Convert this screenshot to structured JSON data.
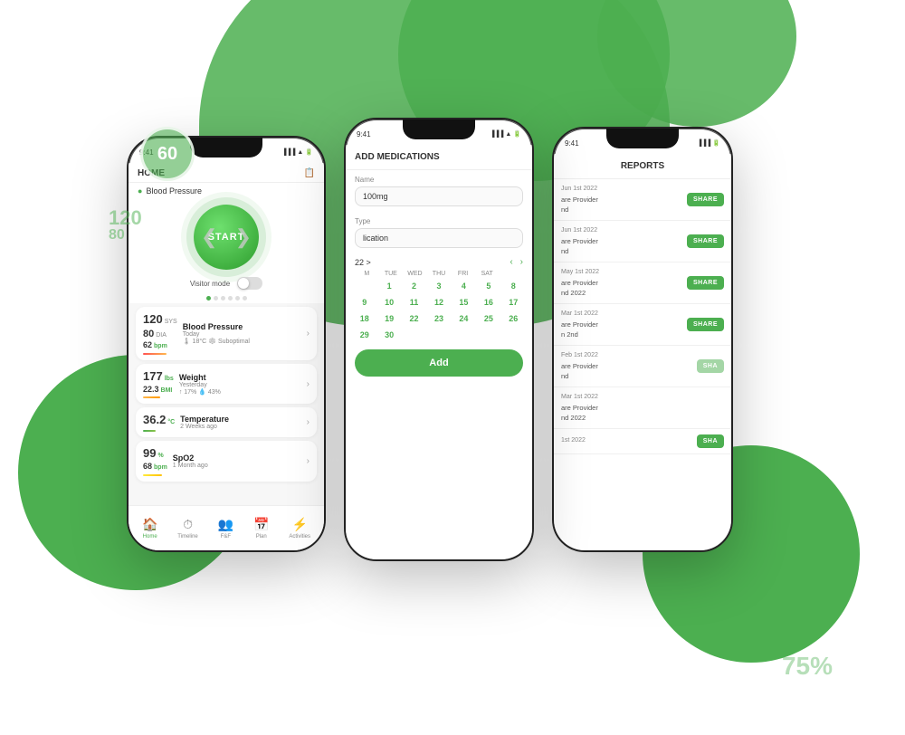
{
  "background": {
    "cloud_color": "#4caf50"
  },
  "phone1": {
    "title": "HOME",
    "blood_pressure_label": "Blood Pressure",
    "start_button": "START",
    "visitor_mode_label": "Visitor mode",
    "cards": [
      {
        "id": "bp",
        "big_value": "120",
        "unit1": "SYS",
        "value2": "80",
        "unit2": "DIA",
        "value3": "62",
        "unit3": "bpm",
        "title": "Blood Pressure",
        "sub": "Today",
        "detail": "🌡 18°C ❄ Suboptimal"
      },
      {
        "id": "weight",
        "big_value": "177",
        "unit1": "lbs",
        "value2": "22.3",
        "unit2": "BMI",
        "title": "Weight",
        "sub": "Yesterday",
        "detail": "↑ 17%  💧 43%"
      },
      {
        "id": "temp",
        "big_value": "36.2",
        "unit1": "°C",
        "title": "Temperature",
        "sub": "2 Weeks ago"
      },
      {
        "id": "spo2",
        "big_value": "99",
        "unit1": "%",
        "value2": "68",
        "unit2": "bpm",
        "title": "SpO2",
        "sub": "1 Month ago"
      }
    ],
    "nav": [
      {
        "label": "Home",
        "icon": "🏠",
        "active": true
      },
      {
        "label": "Timeline",
        "icon": "⏱",
        "active": false
      },
      {
        "label": "F&F",
        "icon": "👥",
        "active": false
      },
      {
        "label": "Plan",
        "icon": "📅",
        "active": false
      },
      {
        "label": "Activities",
        "icon": "⚡",
        "active": false
      }
    ]
  },
  "phone2": {
    "title": "ADD MEDICATIONS",
    "name_label": "Name",
    "name_value": "100mg",
    "type_label": "Type",
    "type_value": "lication",
    "month_label": "22 >",
    "days_header": [
      "M",
      "TUE",
      "WED",
      "THU",
      "FRI",
      "SAT"
    ],
    "cal_days": [
      {
        "day": "",
        "style": "empty"
      },
      {
        "day": "1",
        "style": "green"
      },
      {
        "day": "2",
        "style": "green"
      },
      {
        "day": "3",
        "style": "green"
      },
      {
        "day": "4",
        "style": "green"
      },
      {
        "day": "5",
        "style": "green"
      },
      {
        "day": "8",
        "style": "green"
      },
      {
        "day": "9",
        "style": "green"
      },
      {
        "day": "10",
        "style": "green"
      },
      {
        "day": "11",
        "style": "green"
      },
      {
        "day": "12",
        "style": "green"
      },
      {
        "day": "15",
        "style": "green"
      },
      {
        "day": "16",
        "style": "green"
      },
      {
        "day": "17",
        "style": "green"
      },
      {
        "day": "18",
        "style": "green"
      },
      {
        "day": "19",
        "style": "green"
      },
      {
        "day": "22",
        "style": "green"
      },
      {
        "day": "23",
        "style": "green"
      },
      {
        "day": "24",
        "style": "green"
      },
      {
        "day": "25",
        "style": "green"
      },
      {
        "day": "26",
        "style": "green"
      },
      {
        "day": "29",
        "style": "green"
      },
      {
        "day": "30",
        "style": "green"
      }
    ],
    "add_button": "Add"
  },
  "phone3": {
    "title": "REPORTS",
    "reports": [
      {
        "date": "Jun 1st 2022",
        "provider": "are Provider",
        "detail": "nd",
        "has_share": true
      },
      {
        "date": "Jun 1st 2022",
        "provider": "are Provider",
        "detail": "nd",
        "has_share": true
      },
      {
        "date": "May 1st 2022",
        "provider": "are Provider",
        "detail": "nd 2022",
        "has_share": true
      },
      {
        "date": "Mar 1st 2022",
        "provider": "are Provider",
        "detail": "n 2nd",
        "has_share": true
      },
      {
        "date": "Feb 1st 2022",
        "provider": "are Provider",
        "detail": "nd",
        "has_share": true
      },
      {
        "date": "Mar 1st 2022",
        "provider": "are Provider",
        "detail": "nd 2022",
        "has_share": false
      },
      {
        "date": "1st 2022",
        "provider": "",
        "detail": "",
        "has_share": true
      }
    ],
    "share_label": "SHARE"
  },
  "decorations": {
    "badge_60": "60",
    "badge_120_80": "120\n80",
    "badge_percent": "75%"
  }
}
